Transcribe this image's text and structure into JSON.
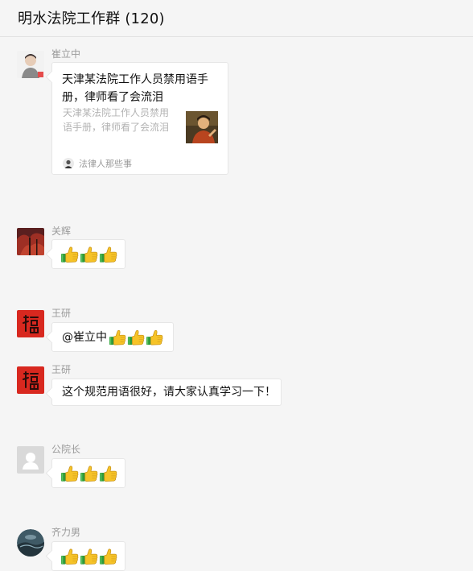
{
  "header": {
    "title": "明水法院工作群 (120)"
  },
  "messages": [
    {
      "sender": "崔立中",
      "link_card": {
        "title": "天津某法院工作人员禁用语手册，律师看了会流泪",
        "description": "天津某法院工作人员禁用语手册，律师看了会流泪",
        "source": "法律人那些事"
      }
    },
    {
      "sender": "关辉",
      "content": "thumbs-up ×3"
    },
    {
      "sender": "王研",
      "text": "@崔立中 "
    },
    {
      "sender": "王研",
      "text": "这个规范用语很好，请大家认真学习一下！"
    },
    {
      "sender": "公院长"
    },
    {
      "sender": "齐力男"
    }
  ],
  "colors": {
    "background": "#f5f5f5",
    "bubble": "#ffffff",
    "sender_name": "#9a9a9a",
    "thumb_yellow": "#f6c327",
    "thumb_cuff": "#2f9a3a"
  }
}
